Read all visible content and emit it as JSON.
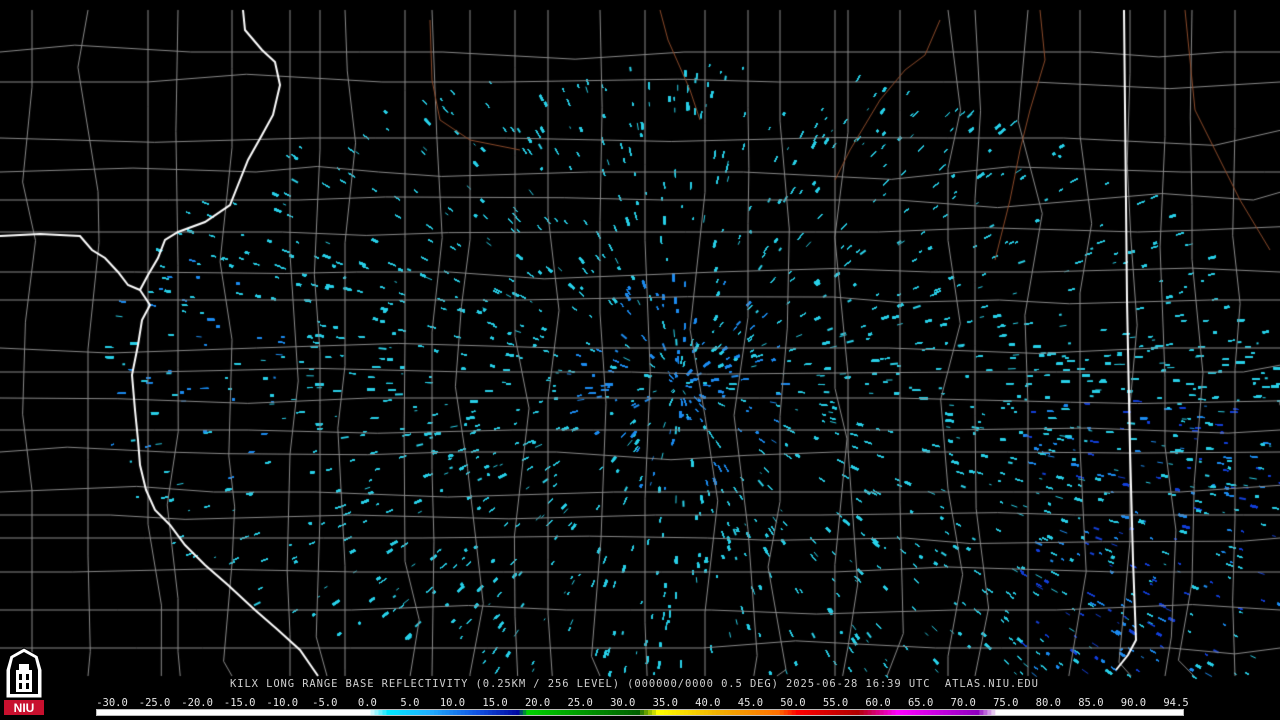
{
  "product": {
    "caption": "KILX LONG RANGE BASE REFLECTIVITY (0.25KM / 256 LEVEL) (000000/0000 0.5 DEG) 2025-06-28 16:39 UTC  ATLAS.NIU.EDU"
  },
  "logo": {
    "text": "NIU",
    "icon": "niu-university-logo-icon"
  },
  "legend": {
    "ticks": [
      "-30.0",
      "-25.0",
      "-20.0",
      "-15.0",
      "-10.0",
      "-5.0",
      "0.0",
      "5.0",
      "10.0",
      "15.0",
      "20.0",
      "25.0",
      "30.0",
      "35.0",
      "40.0",
      "45.0",
      "50.0",
      "55.0",
      "60.0",
      "65.0",
      "70.0",
      "75.0",
      "80.0",
      "85.0",
      "90.0",
      "94.5"
    ],
    "colors": [
      "#ffffff",
      "#ffffff",
      "#ffffff",
      "#ffffff",
      "#ffffff",
      "#ffffff",
      "#00e0ff",
      "#1ea0ff",
      "#1040d0",
      "#0a10a0",
      "#00e000",
      "#00a000",
      "#007000",
      "#ffff00",
      "#e6b800",
      "#ff8c00",
      "#ff0000",
      "#c00000",
      "#a00000",
      "#ff00ff",
      "#a000c0",
      "#ffffff",
      "#ffffff",
      "#ffffff",
      "#ffffff",
      "#ffffff"
    ]
  },
  "colors": {
    "background": "#000000",
    "county_border": "#8a8a8a",
    "state_border": "#ffffff",
    "river": "#8b4a2a",
    "echo_light": "#2ad0e8",
    "echo_medium": "#1e8cf0",
    "echo_heavy": "#1440d8"
  }
}
